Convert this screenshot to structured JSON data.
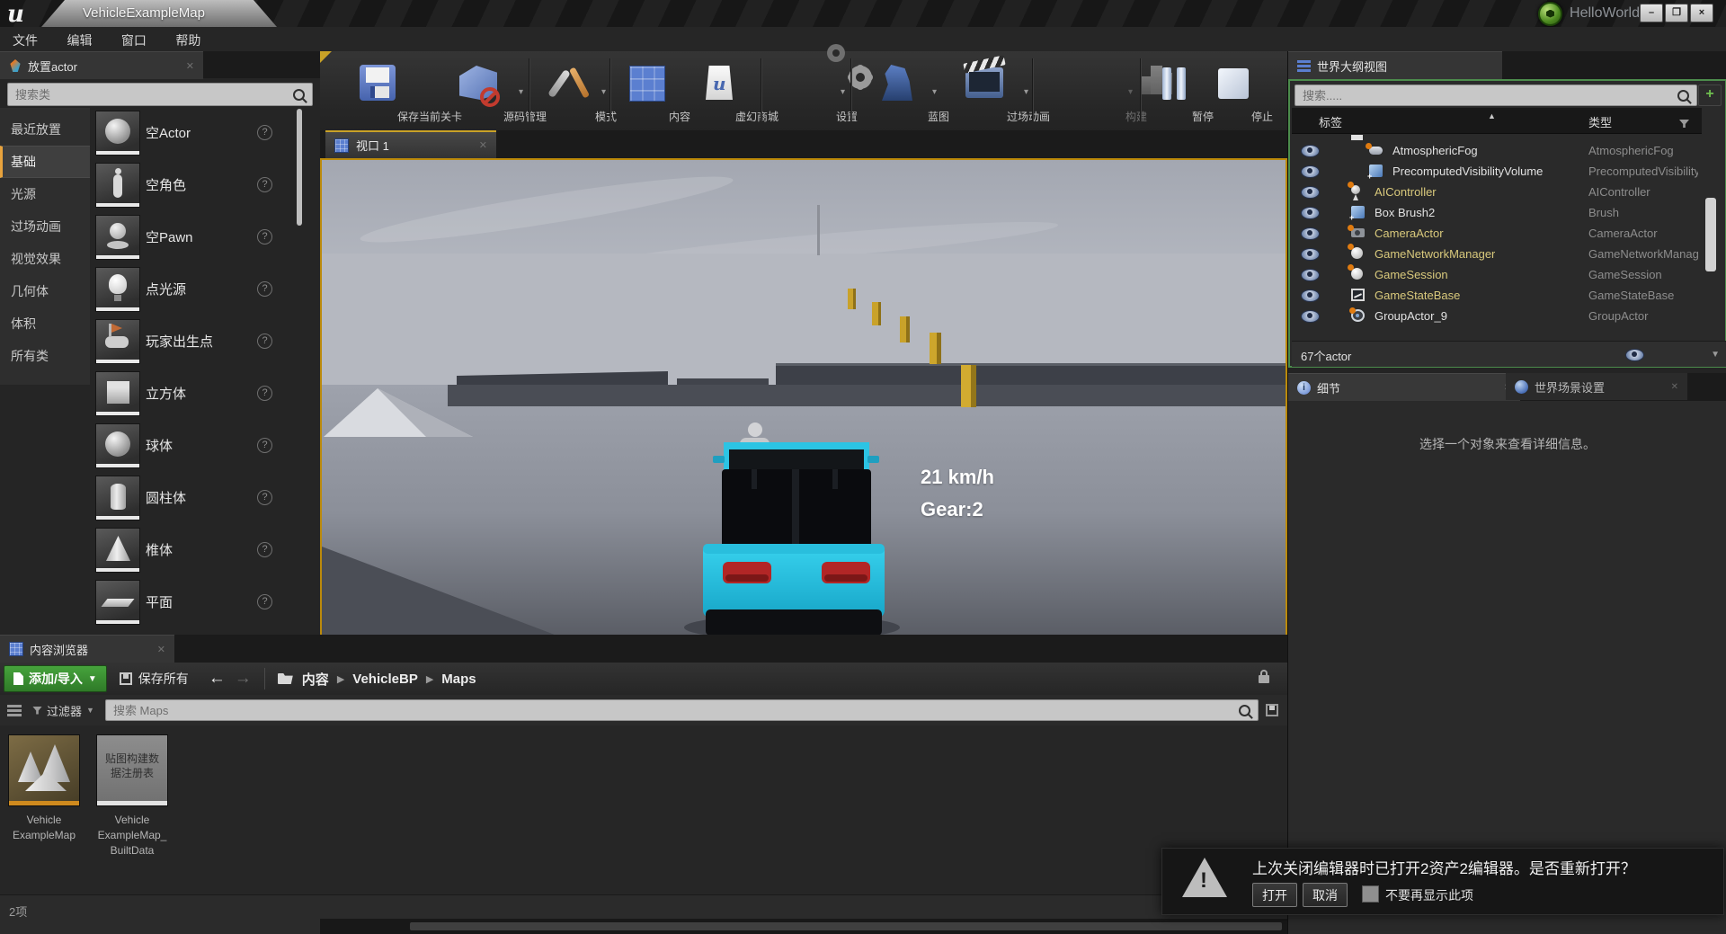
{
  "titlebar": {
    "tab_title": "VehicleExampleMap",
    "project_name": "HelloWorld",
    "minimize": "–",
    "restore": "❐",
    "close": "×"
  },
  "menubar": {
    "items": [
      "文件",
      "编辑",
      "窗口",
      "帮助"
    ]
  },
  "place_actors": {
    "tab_label": "放置actor",
    "search_placeholder": "搜索类",
    "categories": [
      {
        "label": "最近放置"
      },
      {
        "label": "基础"
      },
      {
        "label": "光源"
      },
      {
        "label": "过场动画"
      },
      {
        "label": "视觉效果"
      },
      {
        "label": "几何体"
      },
      {
        "label": "体积"
      },
      {
        "label": "所有类"
      }
    ],
    "items": [
      {
        "label": "空Actor"
      },
      {
        "label": "空角色"
      },
      {
        "label": "空Pawn"
      },
      {
        "label": "点光源"
      },
      {
        "label": "玩家出生点"
      },
      {
        "label": "立方体"
      },
      {
        "label": "球体"
      },
      {
        "label": "圆柱体"
      },
      {
        "label": "椎体"
      },
      {
        "label": "平面"
      }
    ]
  },
  "toolbar": {
    "buttons": [
      {
        "label": "保存当前关卡"
      },
      {
        "label": "源码管理"
      },
      {
        "label": "模式"
      },
      {
        "label": "内容"
      },
      {
        "label": "虚幻商城"
      },
      {
        "label": "设置"
      },
      {
        "label": "蓝图"
      },
      {
        "label": "过场动画"
      },
      {
        "label": "构建"
      },
      {
        "label": "暂停"
      },
      {
        "label": "停止"
      }
    ]
  },
  "viewport": {
    "tab_label": "视口 1",
    "hud_speed": "21 km/h",
    "hud_gear": "Gear:2"
  },
  "outliner": {
    "tab_label": "世界大纲视图",
    "search_placeholder": "搜索.....",
    "col_label": "标签",
    "col_type": "类型",
    "rows": [
      {
        "name": "AtmosphericFog",
        "type": "AtmosphericFog"
      },
      {
        "name": "PrecomputedVisibilityVolume",
        "type": "PrecomputedVisibilityVolume"
      },
      {
        "name": "AIController",
        "type": "AIController"
      },
      {
        "name": "Box Brush2",
        "type": "Brush"
      },
      {
        "name": "CameraActor",
        "type": "CameraActor"
      },
      {
        "name": "GameNetworkManager",
        "type": "GameNetworkManager"
      },
      {
        "name": "GameSession",
        "type": "GameSession"
      },
      {
        "name": "GameStateBase",
        "type": "GameStateBase"
      },
      {
        "name": "GroupActor_9",
        "type": "GroupActor"
      }
    ],
    "footer_count": "67个actor",
    "view_options": "视图选项"
  },
  "details_panel": {
    "tab_details": "细节",
    "tab_world_settings": "世界场景设置",
    "empty_message": "选择一个对象来查看详细信息。"
  },
  "content_browser": {
    "tab_label": "内容浏览器",
    "add_import": "添加/导入",
    "save_all": "保存所有",
    "breadcrumbs": [
      "内容",
      "VehicleBP",
      "Maps"
    ],
    "filters_label": "过滤器",
    "search_placeholder": "搜索 Maps",
    "assets": [
      {
        "label_lines": [
          "Vehicle",
          "ExampleMap"
        ]
      },
      {
        "label_lines": [
          "Vehicle",
          "ExampleMap_",
          "BuiltData"
        ],
        "thumb_lines": [
          "贴图构建数",
          "据注册表"
        ]
      }
    ],
    "items_count": "2项"
  },
  "notification": {
    "message": "上次关闭编辑器时已打开2资产2编辑器。是否重新打开？",
    "open_label": "打开",
    "cancel_label": "取消",
    "dont_show_label": "不要再显示此项"
  },
  "colors": {
    "accent_orange": "#c9a227",
    "pie_border": "#bb8a0b",
    "outliner_green": "#4c8c4c",
    "add_button_green": "#3f9b3f",
    "runtime_actor_yellow": "#d9c97c",
    "car_cyan": "#2cc4e4"
  }
}
